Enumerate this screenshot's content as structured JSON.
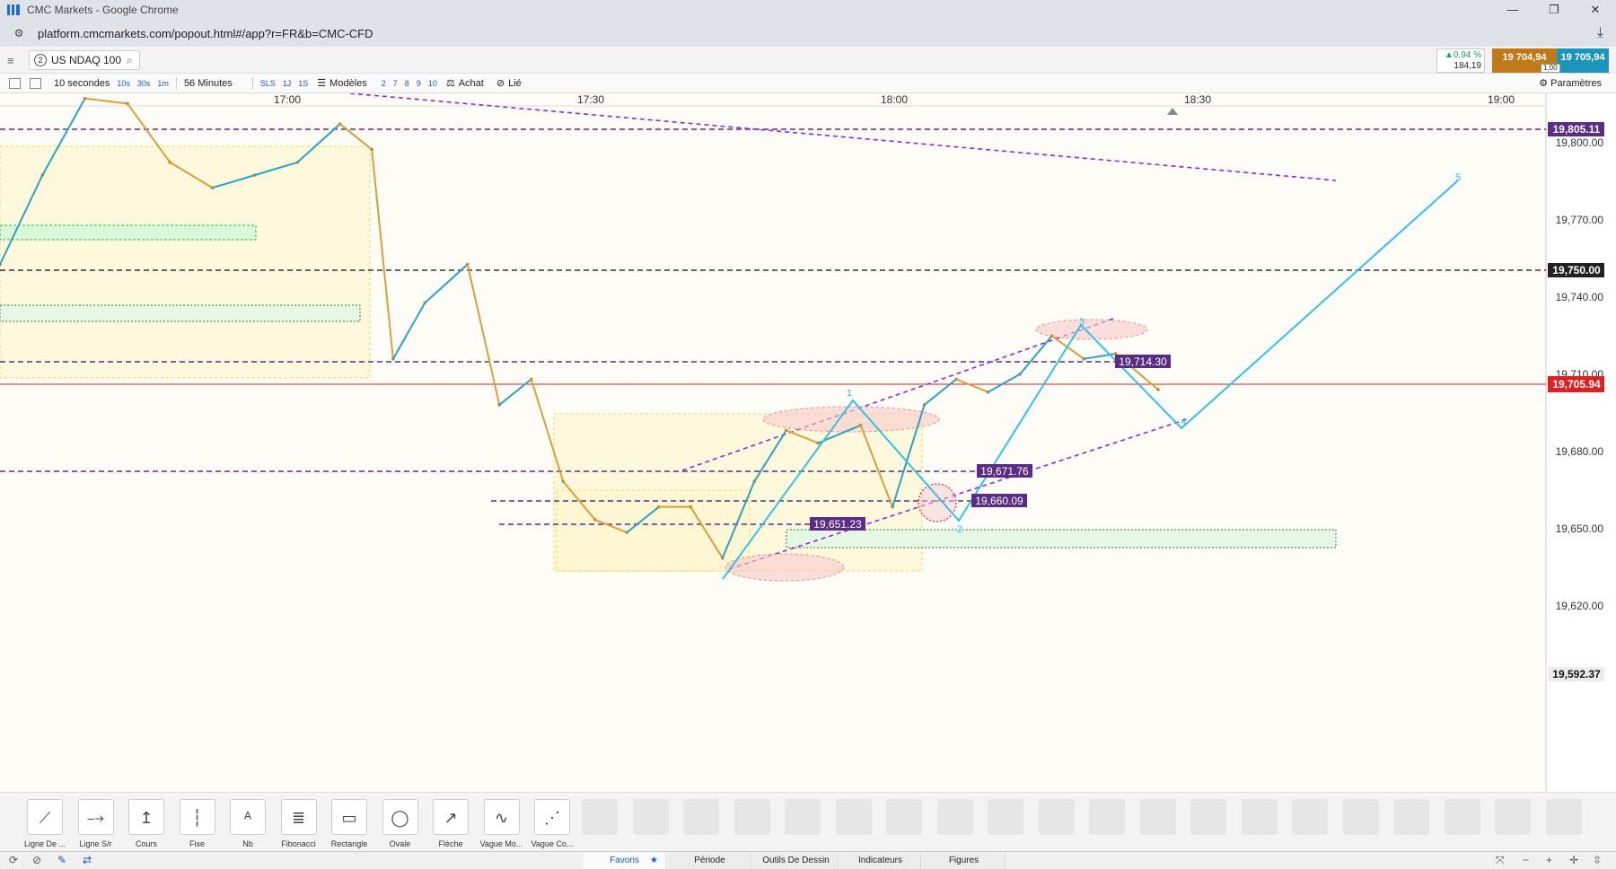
{
  "browser": {
    "title": "CMC Markets - Google Chrome",
    "url": "platform.cmcmarkets.com/popout.html#/app?r=FR&b=CMC-CFD"
  },
  "header": {
    "instrument_number": "2",
    "instrument": "US NDAQ 100",
    "change_pct": "▲0,94 %",
    "change_abs": "184,19",
    "sell_price": "19 704,94",
    "buy_price": "19 705,94",
    "spread": "1,00"
  },
  "toolbar": {
    "interval": "10 secondes",
    "quick_intervals": [
      "10s",
      "30s",
      "1m"
    ],
    "duration": "56 Minutes",
    "sls": "SLS",
    "sls_items": [
      "1J",
      "1S"
    ],
    "models_label": "Modèles",
    "model_items": [
      "2",
      "7",
      "8",
      "9",
      "10"
    ],
    "buy_label": "Achat",
    "linked_label": "Lié",
    "settings_label": "Paramètres"
  },
  "chart_data": {
    "type": "line",
    "title": "",
    "x_ticks": [
      "17:00",
      "17:30",
      "18:00",
      "18:30",
      "19:00"
    ],
    "y_ticks": [
      "19,800.00",
      "19,770.00",
      "19,740.00",
      "19,710.00",
      "19,680.00",
      "19,650.00",
      "19,620.00"
    ],
    "ylim": [
      19592.37,
      19822
    ],
    "price_labels": {
      "level_1": "19,805.11",
      "level_2": "19,750.00",
      "current": "19,705.94",
      "bottom": "19,592.37"
    },
    "annotations": [
      "19,714.30",
      "19,671.76",
      "19,660.09",
      "19,651.23"
    ],
    "wave_labels": [
      "1",
      "2",
      "3",
      "4",
      "5"
    ],
    "price_path": [
      {
        "time": "16:38",
        "price": 19755
      },
      {
        "time": "16:42",
        "price": 19790
      },
      {
        "time": "16:46",
        "price": 19820
      },
      {
        "time": "16:50",
        "price": 19818
      },
      {
        "time": "16:54",
        "price": 19795
      },
      {
        "time": "16:58",
        "price": 19785
      },
      {
        "time": "17:02",
        "price": 19790
      },
      {
        "time": "17:06",
        "price": 19795
      },
      {
        "time": "17:10",
        "price": 19810
      },
      {
        "time": "17:13",
        "price": 19800
      },
      {
        "time": "17:15",
        "price": 19718
      },
      {
        "time": "17:18",
        "price": 19740
      },
      {
        "time": "17:22",
        "price": 19755
      },
      {
        "time": "17:25",
        "price": 19700
      },
      {
        "time": "17:28",
        "price": 19710
      },
      {
        "time": "17:31",
        "price": 19670
      },
      {
        "time": "17:34",
        "price": 19655
      },
      {
        "time": "17:37",
        "price": 19650
      },
      {
        "time": "17:40",
        "price": 19660
      },
      {
        "time": "17:43",
        "price": 19660
      },
      {
        "time": "17:46",
        "price": 19640
      },
      {
        "time": "17:49",
        "price": 19670
      },
      {
        "time": "17:52",
        "price": 19690
      },
      {
        "time": "17:55",
        "price": 19685
      },
      {
        "time": "17:59",
        "price": 19692
      },
      {
        "time": "18:02",
        "price": 19660
      },
      {
        "time": "18:05",
        "price": 19700
      },
      {
        "time": "18:08",
        "price": 19710
      },
      {
        "time": "18:11",
        "price": 19705
      },
      {
        "time": "18:14",
        "price": 19712
      },
      {
        "time": "18:17",
        "price": 19727
      },
      {
        "time": "18:20",
        "price": 19718
      },
      {
        "time": "18:23",
        "price": 19720
      },
      {
        "time": "18:27",
        "price": 19706
      }
    ]
  },
  "drawing_tools": [
    {
      "name": "line-tool",
      "label": "Ligne De ..."
    },
    {
      "name": "sr-line-tool",
      "label": "Ligne S/r"
    },
    {
      "name": "price-tool",
      "label": "Cours"
    },
    {
      "name": "fixed-tool",
      "label": "Fixe"
    },
    {
      "name": "text-tool",
      "label": "Nb"
    },
    {
      "name": "fibonacci-tool",
      "label": "Fibonacci"
    },
    {
      "name": "rectangle-tool",
      "label": "Rectangle"
    },
    {
      "name": "oval-tool",
      "label": "Ovale"
    },
    {
      "name": "arrow-tool",
      "label": "Flèche"
    },
    {
      "name": "wave-motive-tool",
      "label": "Vague Mo..."
    },
    {
      "name": "wave-corrective-tool",
      "label": "Vague Co..."
    }
  ],
  "tabs": [
    "Favoris",
    "Période",
    "Outils De Dessin",
    "Indicateurs",
    "Figures"
  ],
  "colors": {
    "wave": "#33c3e0",
    "dashed_purple": "#8a2be2",
    "price_line": "#e02020",
    "label_purple": "#5b2c83"
  }
}
